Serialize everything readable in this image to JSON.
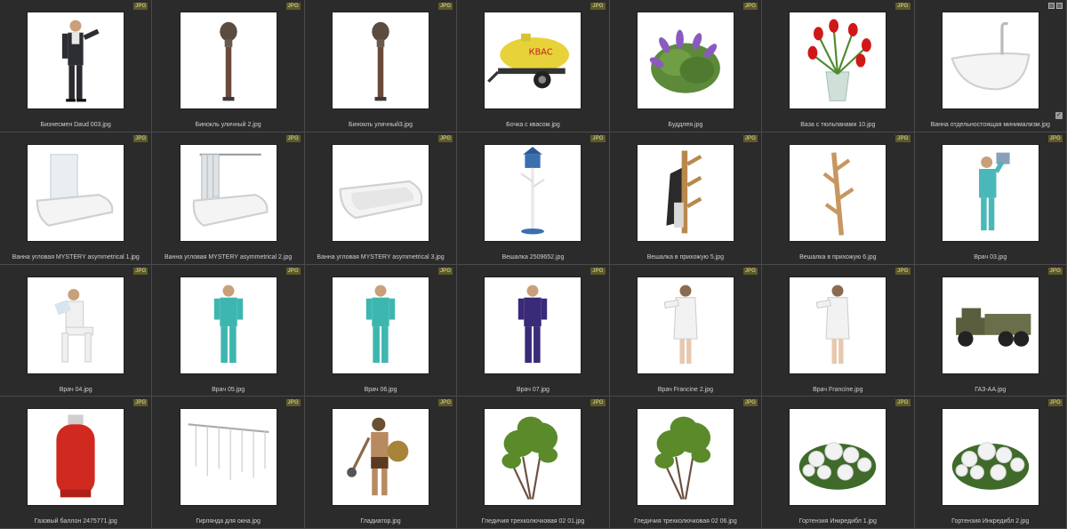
{
  "badge_label": "JPG",
  "items": [
    {
      "name": "Бизнесмен Daud 003.jpg",
      "icon": "businessman-icon"
    },
    {
      "name": "Бинокль уличный 2.jpg",
      "icon": "street-binocular-icon"
    },
    {
      "name": "Бинокль уличный3.jpg",
      "icon": "street-binocular-icon"
    },
    {
      "name": "Бочка с квасом.jpg",
      "icon": "kvass-barrel-icon"
    },
    {
      "name": "Буддлея.jpg",
      "icon": "buddleia-bush-icon"
    },
    {
      "name": "Ваза с тюльпанами 10.jpg",
      "icon": "tulip-vase-icon"
    },
    {
      "name": "Ванна отдельностоящая минимализм.jpg",
      "icon": "freestanding-bathtub-icon"
    },
    {
      "name": "Ванна угловая MYSTERY asymmetrical 1.jpg",
      "icon": "corner-bath-screen-icon"
    },
    {
      "name": "Ванна угловая MYSTERY asymmetrical 2.jpg",
      "icon": "corner-bath-curtain-icon"
    },
    {
      "name": "Ванна угловая MYSTERY asymmetrical 3.jpg",
      "icon": "corner-bath-icon"
    },
    {
      "name": "Вешалка 2509652.jpg",
      "icon": "coat-stand-icon"
    },
    {
      "name": "Вешалка в прихожую 5.jpg",
      "icon": "wall-hanger-with-coats-icon"
    },
    {
      "name": "Вешалка в прихожую 6.jpg",
      "icon": "branch-hanger-icon"
    },
    {
      "name": "Врач 03.jpg",
      "icon": "doctor-xray-icon"
    },
    {
      "name": "Врач 04.jpg",
      "icon": "doctor-seated-icon"
    },
    {
      "name": "Врач 05.jpg",
      "icon": "doctor-standing-icon"
    },
    {
      "name": "Врач 06.jpg",
      "icon": "doctor-standing-icon"
    },
    {
      "name": "Врач 07.jpg",
      "icon": "nurse-standing-icon"
    },
    {
      "name": "Врач Francine 2.jpg",
      "icon": "doctor-francine-icon"
    },
    {
      "name": "Врач Francine.jpg",
      "icon": "doctor-francine-icon"
    },
    {
      "name": "ГАЗ-АА.jpg",
      "icon": "truck-icon"
    },
    {
      "name": "Газовый баллон 2475771.jpg",
      "icon": "gas-cylinder-icon"
    },
    {
      "name": "Гирлянда для окна.jpg",
      "icon": "window-garland-icon"
    },
    {
      "name": "Гладиатор.jpg",
      "icon": "gladiator-icon"
    },
    {
      "name": "Гледичия трехколючковая 02 01.jpg",
      "icon": "honey-locust-tree-icon"
    },
    {
      "name": "Гледичия трехколючковая 02 06.jpg",
      "icon": "honey-locust-tree-icon"
    },
    {
      "name": "Гортензия Инкредибл 1.jpg",
      "icon": "hydrangea-bush-icon"
    },
    {
      "name": "Гортензия Инкредибл 2.jpg",
      "icon": "hydrangea-bush-icon"
    }
  ],
  "colors": {
    "background": "#2b2b2b",
    "badge_bg": "#5d5a2a",
    "badge_text": "#e9e29c",
    "label_text": "#cfcfcf"
  }
}
